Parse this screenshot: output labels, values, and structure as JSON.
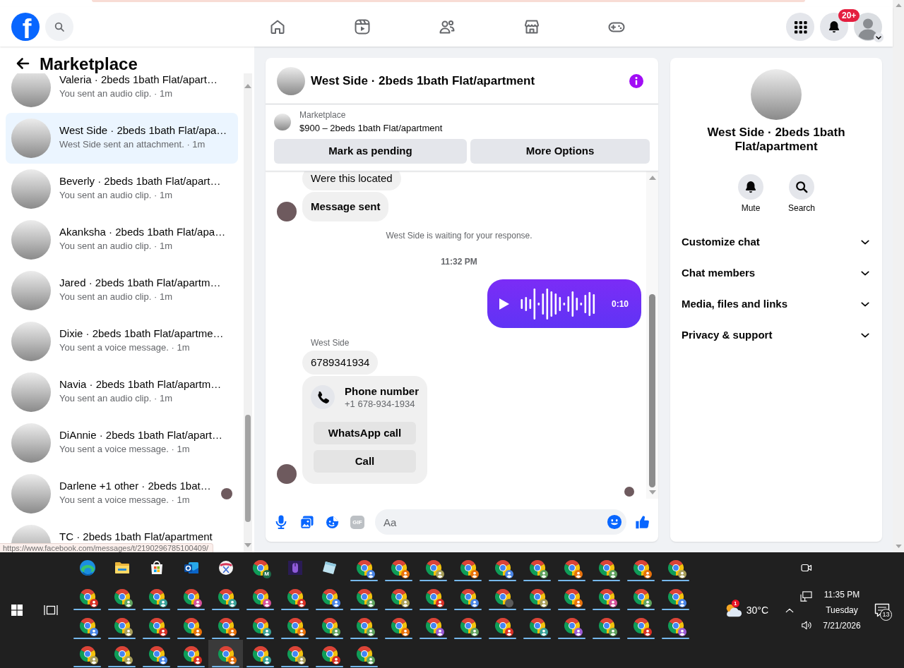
{
  "page": {
    "status_url": "https://www.facebook.com/messages/t/2190296785100409/"
  },
  "top_nav": {
    "logo": "f",
    "tabs": [
      {
        "kind": "home",
        "selected": false
      },
      {
        "kind": "video",
        "selected": false
      },
      {
        "kind": "friends",
        "selected": false
      },
      {
        "kind": "marketplace",
        "selected": false
      },
      {
        "kind": "gaming",
        "selected": false
      }
    ],
    "notification_count": "20+"
  },
  "sidebar": {
    "title": "Marketplace",
    "conversations": [
      {
        "title": "Valeria · 2beds 1bath Flat/apart…",
        "preview": "You sent an audio clip. · 1m",
        "selected": false
      },
      {
        "title": "West Side · 2beds 1bath Flat/apa…",
        "preview": "West Side sent an attachment. · 1m",
        "selected": true
      },
      {
        "title": "Beverly · 2beds 1bath Flat/apart…",
        "preview": "You sent an audio clip. · 1m",
        "selected": false
      },
      {
        "title": "Akanksha · 2beds 1bath Flat/apa…",
        "preview": "You sent an audio clip. · 1m",
        "selected": false
      },
      {
        "title": "Jared · 2beds 1bath Flat/apartm…",
        "preview": "You sent an audio clip. · 1m",
        "selected": false
      },
      {
        "title": "Dixie · 2beds 1bath Flat/apartme…",
        "preview": "You sent a voice message. · 1m",
        "selected": false
      },
      {
        "title": "Navia · 2beds 1bath Flat/apartm…",
        "preview": "You sent an audio clip. · 1m",
        "selected": false
      },
      {
        "title": "DiAnnie · 2beds 1bath Flat/apart…",
        "preview": "You sent a voice message. · 1m",
        "selected": false
      },
      {
        "title": "Darlene +1 other · 2beds 1bat…",
        "preview": "You sent a voice message. · 1m",
        "selected": false,
        "seen": true
      },
      {
        "title": "TC · 2beds 1bath Flat/apartment",
        "selected": false
      }
    ]
  },
  "chat": {
    "title": "West Side · 2beds 1bath Flat/apartment",
    "listing": {
      "source": "Marketplace",
      "summary": "$900 – 2beds 1bath Flat/apartment"
    },
    "actions": [
      "Mark as pending",
      "More Options"
    ],
    "messages": [
      {
        "kind": "text",
        "outgoing": false,
        "text": "Were this located",
        "bold": false,
        "avatar": false
      },
      {
        "kind": "text",
        "outgoing": false,
        "text": "Message sent",
        "bold": true,
        "avatar": true
      },
      {
        "kind": "notice",
        "text": "West Side is waiting for your response."
      },
      {
        "kind": "time",
        "text": "11:32 PM"
      },
      {
        "kind": "audio",
        "outgoing": true,
        "duration": "0:10"
      },
      {
        "kind": "sender",
        "text": "West Side"
      },
      {
        "kind": "text",
        "outgoing": false,
        "text": "6789341934",
        "bold": false,
        "avatar": false
      },
      {
        "kind": "phone",
        "outgoing": false,
        "title": "Phone number",
        "number": "+1 678-934-1934",
        "buttons": [
          "WhatsApp call",
          "Call"
        ],
        "avatar": true
      },
      {
        "kind": "seen"
      }
    ],
    "composer": {
      "tools": [
        {
          "kind": "mic",
          "disabled": false
        },
        {
          "kind": "photo",
          "disabled": false
        },
        {
          "kind": "sticker",
          "disabled": false
        },
        {
          "kind": "gif",
          "label": "GIF",
          "disabled": true
        }
      ],
      "placeholder": "Aa"
    }
  },
  "details": {
    "title": "West Side · 2beds 1bath Flat/apartment",
    "actions": [
      {
        "kind": "mute",
        "label": "Mute"
      },
      {
        "kind": "search",
        "label": "Search"
      }
    ],
    "sections": [
      {
        "label": "Customize chat",
        "expanded": false
      },
      {
        "label": "Chat members",
        "expanded": false
      },
      {
        "label": "Media, files and links",
        "expanded": false
      },
      {
        "label": "Privacy & support",
        "expanded": false
      }
    ]
  },
  "taskbar": {
    "apps": [
      {
        "kind": "browser",
        "running": false,
        "selected": false
      },
      {
        "kind": "folder",
        "running": false,
        "selected": false
      },
      {
        "kind": "store",
        "running": false,
        "selected": false
      },
      {
        "kind": "mail",
        "running": false,
        "selected": false
      },
      {
        "kind": "scissors",
        "running": false,
        "selected": false
      },
      {
        "kind": "profile_browser",
        "initial": "M",
        "color": "#1e6b4a",
        "running": false,
        "selected": false
      },
      {
        "kind": "mouse",
        "running": false,
        "selected": false
      },
      {
        "kind": "notepad",
        "running": false,
        "selected": false
      },
      {
        "kind": "profile_browser",
        "color": "#4a86e8",
        "running": true,
        "selected": false
      },
      {
        "kind": "profile_browser",
        "color": "#e8710a",
        "running": true,
        "selected": false
      },
      {
        "kind": "profile_browser",
        "color": "#a89f5b",
        "running": true,
        "selected": false
      },
      {
        "kind": "profile_browser",
        "color": "#e8710a",
        "running": true,
        "selected": false
      },
      {
        "kind": "profile_browser",
        "color": "#4a86e8",
        "running": true,
        "selected": false
      },
      {
        "kind": "profile_browser",
        "color": "#5fa35f",
        "running": true,
        "selected": false
      },
      {
        "kind": "profile_browser",
        "color": "#e8710a",
        "running": true,
        "selected": false
      },
      {
        "kind": "profile_browser",
        "color": "#5fa35f",
        "running": true,
        "selected": false
      },
      {
        "kind": "profile_browser",
        "color": "#e8710a",
        "running": true,
        "selected": false
      },
      {
        "kind": "profile_browser",
        "color": "#a89f5b",
        "running": true,
        "selected": false
      },
      {
        "kind": "profile_browser",
        "color": "#d93025",
        "running": true,
        "selected": false
      },
      {
        "kind": "profile_browser",
        "color": "#5fa35f",
        "running": true,
        "selected": false
      },
      {
        "kind": "profile_browser",
        "color": "#3aa39a",
        "running": true,
        "selected": false
      },
      {
        "kind": "profile_browser",
        "color": "#d6529b",
        "running": true,
        "selected": false
      },
      {
        "kind": "profile_browser",
        "color": "#3aa39a",
        "running": true,
        "selected": false
      },
      {
        "kind": "profile_browser",
        "color": "#d6529b",
        "running": true,
        "selected": false
      },
      {
        "kind": "profile_browser",
        "color": "#d93025",
        "running": true,
        "selected": false
      },
      {
        "kind": "profile_browser",
        "color": "#4a86e8",
        "running": true,
        "selected": false
      },
      {
        "kind": "profile_browser",
        "color": "#5fa35f",
        "running": true,
        "selected": false
      },
      {
        "kind": "profile_browser",
        "color": "#a89f5b",
        "running": true,
        "selected": false
      },
      {
        "kind": "profile_browser",
        "color": "#d93025",
        "running": true,
        "selected": false
      },
      {
        "kind": "profile_browser",
        "color": "#4a86e8",
        "running": true,
        "selected": false
      },
      {
        "kind": "profile_browser_photo",
        "running": true,
        "selected": false
      },
      {
        "kind": "profile_browser",
        "color": "#a89f5b",
        "running": true,
        "selected": false
      },
      {
        "kind": "profile_browser",
        "color": "#e8710a",
        "running": true,
        "selected": false
      },
      {
        "kind": "profile_browser",
        "color": "#d6529b",
        "running": true,
        "selected": false
      },
      {
        "kind": "profile_browser",
        "color": "#5fa35f",
        "running": true,
        "selected": false
      },
      {
        "kind": "profile_browser",
        "color": "#4a86e8",
        "running": true,
        "selected": false
      },
      {
        "kind": "profile_browser",
        "color": "#4a86e8",
        "running": true,
        "selected": false
      },
      {
        "kind": "profile_browser",
        "color": "#a89f5b",
        "running": true,
        "selected": false
      },
      {
        "kind": "profile_browser",
        "color": "#d93025",
        "running": true,
        "selected": false
      },
      {
        "kind": "profile_browser",
        "color": "#e8710a",
        "running": true,
        "selected": false
      },
      {
        "kind": "profile_browser",
        "color": "#e8710a",
        "running": true,
        "selected": false
      },
      {
        "kind": "profile_browser",
        "color": "#3aa39a",
        "running": true,
        "selected": false
      },
      {
        "kind": "profile_browser",
        "color": "#e8710a",
        "running": true,
        "selected": false
      },
      {
        "kind": "profile_browser",
        "color": "#5fa35f",
        "running": true,
        "selected": false
      },
      {
        "kind": "profile_browser",
        "color": "#5fa35f",
        "running": true,
        "selected": false
      },
      {
        "kind": "profile_browser",
        "color": "#e8710a",
        "running": true,
        "selected": false
      },
      {
        "kind": "profile_browser",
        "color": "#9c5bd6",
        "running": true,
        "selected": false
      },
      {
        "kind": "profile_browser",
        "color": "#5fa35f",
        "running": true,
        "selected": false
      },
      {
        "kind": "profile_browser",
        "color": "#d93025",
        "running": true,
        "selected": false
      },
      {
        "kind": "profile_browser",
        "color": "#3aa39a",
        "running": true,
        "selected": false
      },
      {
        "kind": "profile_browser",
        "color": "#9c5bd6",
        "running": true,
        "selected": false
      },
      {
        "kind": "profile_browser",
        "color": "#5fa35f",
        "running": true,
        "selected": false
      },
      {
        "kind": "profile_browser",
        "color": "#d93025",
        "running": true,
        "selected": false
      },
      {
        "kind": "profile_browser",
        "color": "#9c5bd6",
        "running": true,
        "selected": false
      },
      {
        "kind": "profile_browser",
        "color": "#a89f5b",
        "running": true,
        "selected": false
      },
      {
        "kind": "profile_browser",
        "color": "#a89f5b",
        "running": true,
        "selected": false
      },
      {
        "kind": "profile_browser",
        "color": "#4a86e8",
        "running": true,
        "selected": false
      },
      {
        "kind": "profile_browser",
        "color": "#d93025",
        "running": true,
        "selected": false
      },
      {
        "kind": "profile_browser",
        "color": "#e8710a",
        "running": true,
        "selected": true
      },
      {
        "kind": "profile_browser",
        "color": "#3aa39a",
        "running": true,
        "selected": false
      },
      {
        "kind": "profile_browser",
        "color": "#a89f5b",
        "running": true,
        "selected": false
      },
      {
        "kind": "profile_browser",
        "color": "#d93025",
        "running": true,
        "selected": false
      },
      {
        "kind": "profile_browser",
        "color": "#5fa35f",
        "running": true,
        "selected": false
      }
    ],
    "tray": {
      "weather": {
        "temperature": "30°C",
        "badge": "1"
      },
      "clock": {
        "time": "11:35 PM",
        "day": "Tuesday",
        "date": "7/21/2026"
      },
      "notification_count": "13"
    }
  }
}
